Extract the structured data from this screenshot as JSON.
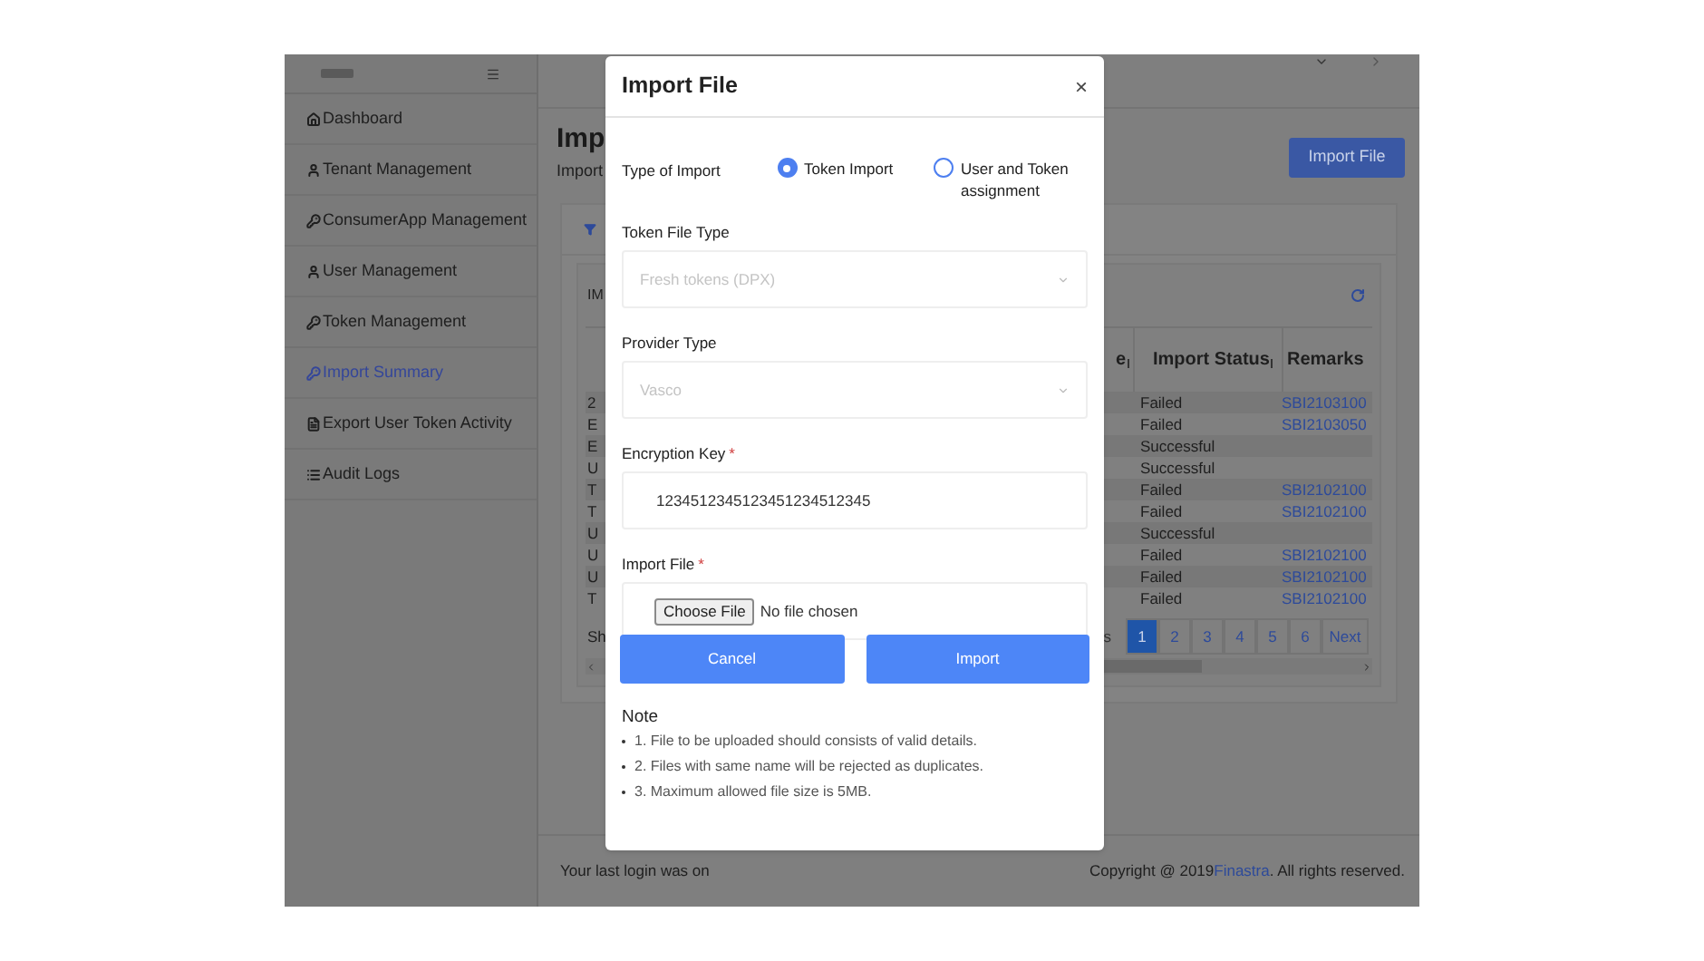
{
  "sidebar": {
    "items": [
      {
        "label": "Dashboard",
        "selected": false
      },
      {
        "label": "Tenant Management",
        "selected": false
      },
      {
        "label": "ConsumerApp Management",
        "selected": false
      },
      {
        "label": "User Management",
        "selected": false
      },
      {
        "label": "Token Management",
        "selected": false
      },
      {
        "label": "Import Summary",
        "selected": true
      },
      {
        "label": "Export User Token Activity",
        "selected": false
      },
      {
        "label": "Audit Logs",
        "selected": false
      }
    ]
  },
  "page": {
    "title": "Imp",
    "subtitle": "Import",
    "import_button": "Import File",
    "card_title": "IM"
  },
  "table": {
    "columns": [
      {
        "label": "e",
        "sortable": true
      },
      {
        "label": "Import Status",
        "sortable": true
      },
      {
        "label": "Remarks",
        "sortable": false
      }
    ],
    "rows": [
      {
        "column_1": "2",
        "status": "Failed",
        "remarks": "SBI2103100"
      },
      {
        "column_1": "E",
        "status": "Failed",
        "remarks": "SBI2103050"
      },
      {
        "column_1": "E",
        "status": "Successful",
        "remarks": ""
      },
      {
        "column_1": "U",
        "status": "Successful",
        "remarks": ""
      },
      {
        "column_1": "T",
        "status": "Failed",
        "remarks": "SBI2102100"
      },
      {
        "column_1": "T",
        "status": "Failed",
        "remarks": "SBI2102100"
      },
      {
        "column_1": "U",
        "status": "Successful",
        "remarks": ""
      },
      {
        "column_1": "U",
        "status": "Failed",
        "remarks": "SBI2102100"
      },
      {
        "column_1": "U",
        "status": "Failed",
        "remarks": "SBI2102100"
      },
      {
        "column_1": "T",
        "status": "Failed",
        "remarks": "SBI2102100"
      }
    ]
  },
  "pagination": {
    "summary": "Sh",
    "previous": "s",
    "pages": [
      {
        "label": "1",
        "selected": true
      },
      {
        "label": "2",
        "selected": false
      },
      {
        "label": "3",
        "selected": false
      },
      {
        "label": "4",
        "selected": false
      },
      {
        "label": "5",
        "selected": false
      },
      {
        "label": "6",
        "selected": false
      }
    ],
    "next": "Next"
  },
  "footer": {
    "last_login": "Your last login was on",
    "copyright_prefix": "Copyright @ 2019 ",
    "copyright_link": "Finastra",
    "copyright_suffix": ". All rights reserved."
  },
  "dialog": {
    "title": "Import File",
    "close": "×",
    "type_label": "Type of Import",
    "type_options": [
      {
        "label": "Token Import",
        "selected": true
      },
      {
        "label": "User and Token assignment",
        "selected": false
      }
    ],
    "fields": [
      {
        "kind": "select",
        "label": "Token File Type",
        "value": "Fresh tokens (DPX)",
        "disabled": true
      },
      {
        "kind": "select",
        "label": "Provider Type",
        "value": "Vasco",
        "disabled": true
      },
      {
        "kind": "text",
        "label": "Encryption Key",
        "required_mark": "*",
        "value": "1234512345123451234512345"
      },
      {
        "kind": "file",
        "label": "Import File",
        "required_mark": "*",
        "button": "Choose File",
        "status": "No file chosen"
      }
    ],
    "buttons": [
      "Cancel",
      "Import"
    ],
    "note": {
      "title": "Note",
      "items": [
        "1. File to be uploaded should consists of valid details.",
        "2. Files with same name will be rejected as duplicates.",
        "3. Maximum allowed file size is 5MB."
      ]
    }
  }
}
